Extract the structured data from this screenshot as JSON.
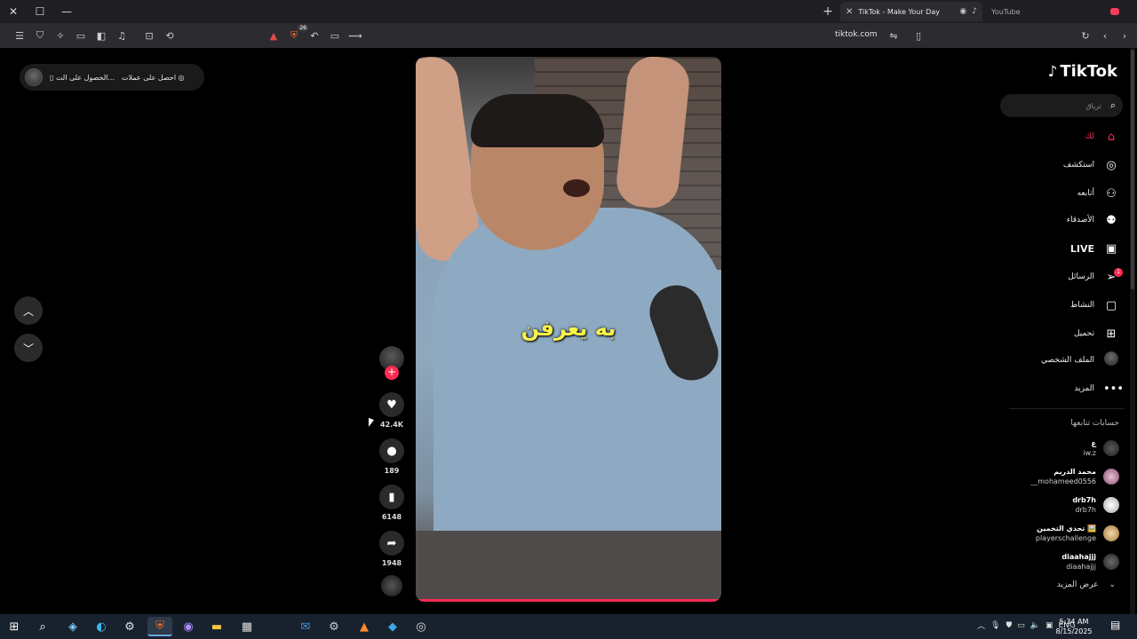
{
  "browser": {
    "tabs": [
      {
        "title": "TikTok - Make Your Day",
        "active": true
      },
      {
        "title": "YouTube",
        "active": false
      }
    ],
    "url": "tiktok.com",
    "brave_count": "26"
  },
  "page": {
    "promo": {
      "item1": "احصل على عملات",
      "item2": "الحصول على الت..."
    },
    "video": {
      "caption": "به يعرفن"
    },
    "actions": {
      "likes": "42.4K",
      "comments": "189",
      "bookmarks": "6148",
      "shares": "1948"
    },
    "sidebar": {
      "logo": "TikTok",
      "search_placeholder": "ترياق",
      "nav": [
        {
          "label": "لك",
          "icon": "home-icon",
          "active": true
        },
        {
          "label": "استكشف",
          "icon": "compass-icon"
        },
        {
          "label": "أتابعه",
          "icon": "following-icon"
        },
        {
          "label": "الأصدقاء",
          "icon": "friends-icon"
        },
        {
          "label": "LIVE",
          "icon": "live-icon"
        },
        {
          "label": "الرسائل",
          "icon": "messages-icon",
          "badge": "1"
        },
        {
          "label": "النشاط",
          "icon": "activity-icon"
        },
        {
          "label": "تحميل",
          "icon": "upload-icon"
        },
        {
          "label": "الملف الشخصي",
          "icon": "profile-avatar"
        },
        {
          "label": "المزيد",
          "icon": "more-icon"
        }
      ],
      "following_title": "حسابات تتابعها",
      "accounts": [
        {
          "name": "ع",
          "username": "iw.z"
        },
        {
          "name": "محمد الدريم",
          "username": "__mohameed0556"
        },
        {
          "name": "drb7h",
          "username": "drb7h"
        },
        {
          "name": "تحدي التخمين 🖼️",
          "username": "playerschallenge"
        },
        {
          "name": "diaahajjj",
          "username": "diaahajjj"
        }
      ],
      "see_more": "عرض المزيد"
    }
  },
  "taskbar": {
    "lang": "ENG",
    "time": "5:34 AM",
    "date": "8/15/2025"
  },
  "colors": {
    "accent": "#fe2c55",
    "caption": "#f7f24a"
  }
}
